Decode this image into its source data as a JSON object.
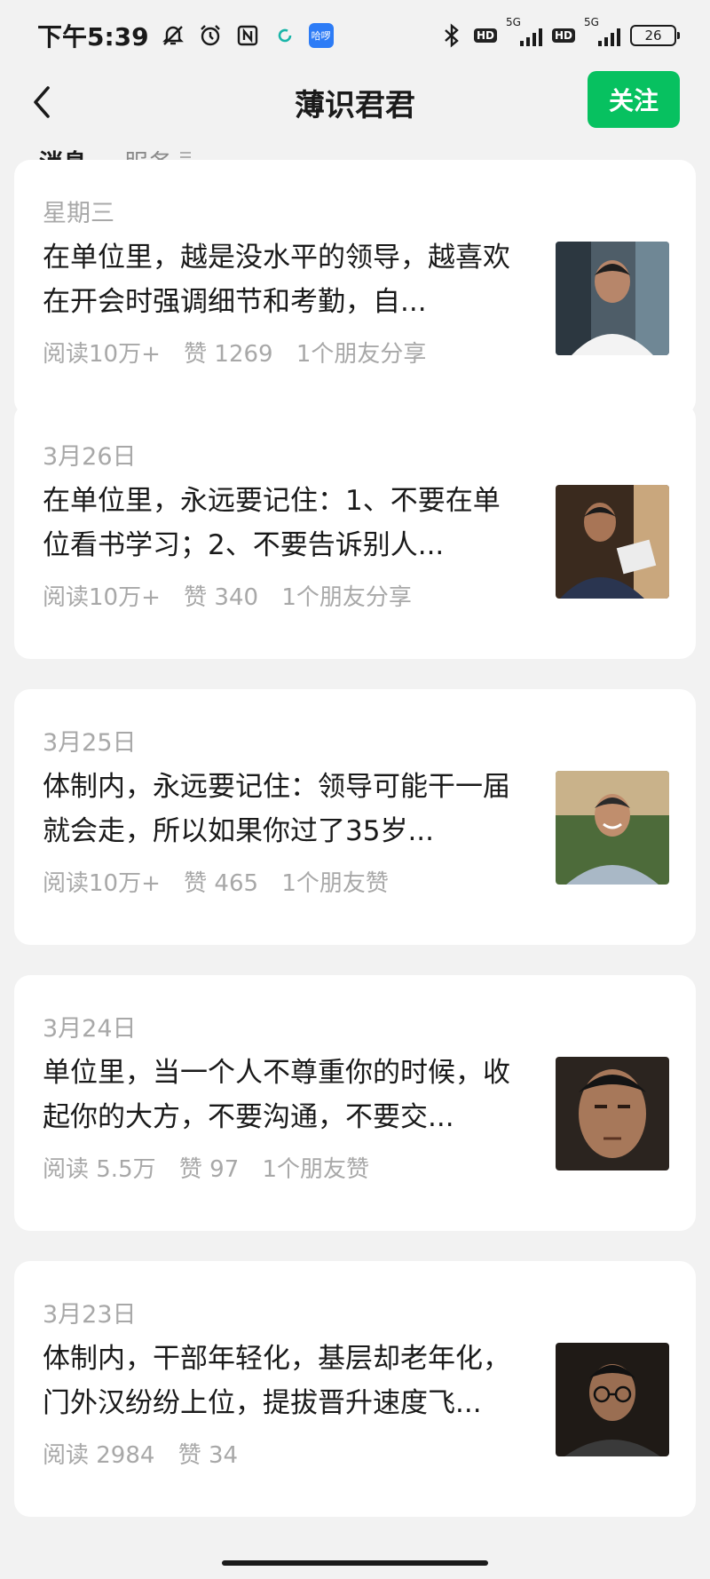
{
  "status_bar": {
    "time": "下午5:39",
    "app_badge": "哈啰",
    "net_type_1": "5G",
    "net_type_2": "5G",
    "hd_1": "HD",
    "hd_2": "HD",
    "battery": "26"
  },
  "nav": {
    "title": "薄识君君",
    "follow_label": "关注"
  },
  "tabs": {
    "messages": "消息",
    "services": "服务"
  },
  "articles": [
    {
      "date": "星期三",
      "title": "在单位里，越是没水平的领导，越喜欢在开会时强调细节和考勤，自...",
      "reads": "阅读10万+",
      "likes": "赞 1269",
      "social": "1个朋友分享"
    },
    {
      "date": "3月26日",
      "title": "在单位里，永远要记住：1、不要在单位看书学习；2、不要告诉别人...",
      "reads": "阅读10万+",
      "likes": "赞 340",
      "social": "1个朋友分享"
    },
    {
      "date": "3月25日",
      "title": "体制内，永远要记住：领导可能干一届就会走，所以如果你过了35岁...",
      "reads": "阅读10万+",
      "likes": "赞 465",
      "social": "1个朋友赞"
    },
    {
      "date": "3月24日",
      "title": "单位里，当一个人不尊重你的时候，收起你的大方，不要沟通，不要交...",
      "reads": "阅读 5.5万",
      "likes": "赞 97",
      "social": "1个朋友赞"
    },
    {
      "date": "3月23日",
      "title": "体制内，干部年轻化，基层却老年化，门外汉纷纷上位，提拔晋升速度飞...",
      "reads": "阅读 2984",
      "likes": "赞 34",
      "social": ""
    }
  ]
}
